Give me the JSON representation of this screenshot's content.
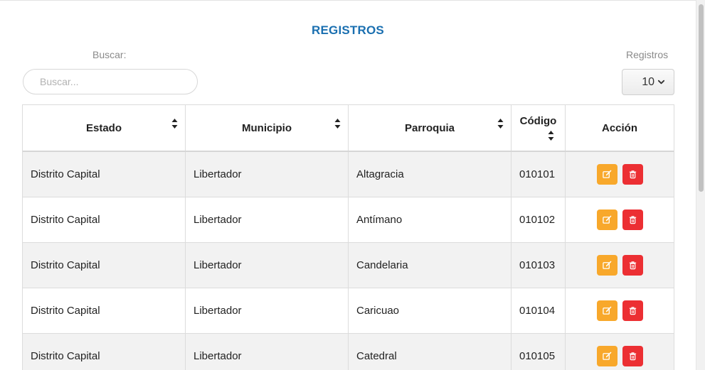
{
  "page": {
    "title": "REGISTROS"
  },
  "search": {
    "label": "Buscar:",
    "placeholder": "Buscar...",
    "value": ""
  },
  "page_size": {
    "label": "Registros",
    "selected": "10"
  },
  "table": {
    "columns": [
      "Estado",
      "Municipio",
      "Parroquia",
      "Código",
      "Acción"
    ],
    "rows": [
      {
        "estado": "Distrito Capital",
        "municipio": "Libertador",
        "parroquia": "Altagracia",
        "codigo": "010101"
      },
      {
        "estado": "Distrito Capital",
        "municipio": "Libertador",
        "parroquia": "Antímano",
        "codigo": "010102"
      },
      {
        "estado": "Distrito Capital",
        "municipio": "Libertador",
        "parroquia": "Candelaria",
        "codigo": "010103"
      },
      {
        "estado": "Distrito Capital",
        "municipio": "Libertador",
        "parroquia": "Caricuao",
        "codigo": "010104"
      },
      {
        "estado": "Distrito Capital",
        "municipio": "Libertador",
        "parroquia": "Catedral",
        "codigo": "010105"
      }
    ],
    "actions": {
      "edit_icon": "edit-icon",
      "delete_icon": "trash-icon"
    }
  },
  "colors": {
    "title": "#1a6fb0",
    "edit_button": "#f8a82b",
    "delete_button": "#ec2f33",
    "alt_row": "#f2f2f2"
  }
}
